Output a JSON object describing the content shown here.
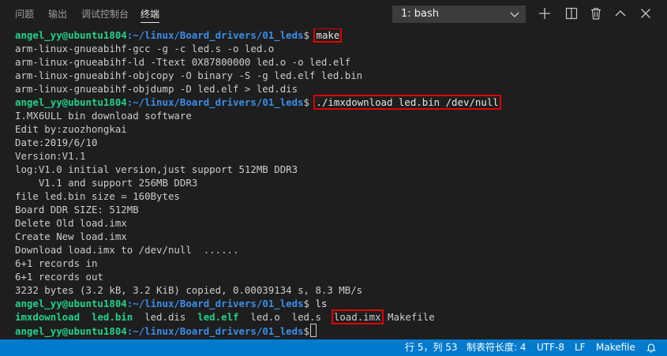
{
  "panel": {
    "tabs": [
      {
        "label": "问题"
      },
      {
        "label": "输出"
      },
      {
        "label": "调试控制台"
      },
      {
        "label": "终端"
      }
    ],
    "active_tab": "终端",
    "terminal_select": "1: bash"
  },
  "terminal": {
    "prompt": {
      "user": "angel_yy@ubuntu1804",
      "path": ":~/linux/Board_drivers/01_leds",
      "dollar": "$"
    },
    "cmd1": "make",
    "out_make": [
      "arm-linux-gnueabihf-gcc -g -c led.s -o led.o",
      "arm-linux-gnueabihf-ld -Ttext 0X87800000 led.o -o led.elf",
      "arm-linux-gnueabihf-objcopy -O binary -S -g led.elf led.bin",
      "arm-linux-gnueabihf-objdump -D led.elf > led.dis"
    ],
    "cmd2": "./imxdownload led.bin /dev/null",
    "out_dl": [
      "I.MX6ULL bin download software",
      "Edit by:zuozhongkai",
      "Date:2019/6/10",
      "Version:V1.1",
      "log:V1.0 initial version,just support 512MB DDR3",
      "    V1.1 and support 256MB DDR3",
      "file led.bin size = 160Bytes",
      "Board DDR SIZE: 512MB",
      "Delete Old load.imx",
      "Create New load.imx",
      "Download load.imx to /dev/null  ......",
      "6+1 records in",
      "6+1 records out",
      "3232 bytes (3.2 kB, 3.2 KiB) copied, 0.00039134 s, 8.3 MB/s"
    ],
    "cmd3": "ls",
    "ls_items": [
      {
        "name": "imxdownload",
        "kind": "exec"
      },
      {
        "name": "led.bin",
        "kind": "exec"
      },
      {
        "name": "led.dis",
        "kind": "file"
      },
      {
        "name": "led.elf",
        "kind": "exec"
      },
      {
        "name": "led.o",
        "kind": "file"
      },
      {
        "name": "led.s",
        "kind": "file"
      },
      {
        "name": "load.imx",
        "kind": "file",
        "highlighted": true
      },
      {
        "name": "Makefile",
        "kind": "file"
      }
    ]
  },
  "status_bar": {
    "position": "行 5，列 53",
    "indent": "制表符长度: 4",
    "encoding": "UTF-8",
    "eol": "LF",
    "language": "Makefile",
    "bell_icon": "bell-icon"
  },
  "colors": {
    "background": "#1e1e1e",
    "prompt_user": "#23d18b",
    "prompt_path": "#3b8eea",
    "executable": "#23d18b",
    "highlight_box": "#e00000",
    "status_bar": "#007acc"
  }
}
